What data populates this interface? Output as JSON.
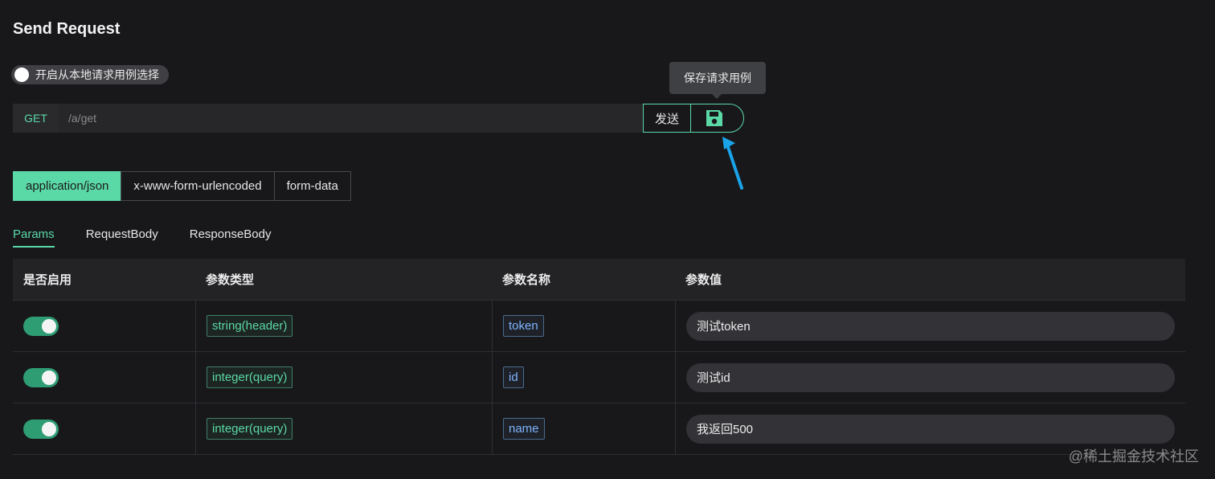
{
  "title": "Send Request",
  "local_switch": {
    "label": "开启从本地请求用例选择",
    "on": false
  },
  "tooltip": "保存请求用例",
  "request": {
    "method": "GET",
    "url_placeholder": "/a/get",
    "send_label": "发送",
    "save_icon": "save-icon"
  },
  "content_types": [
    {
      "label": "application/json",
      "active": true
    },
    {
      "label": "x-www-form-urlencoded",
      "active": false
    },
    {
      "label": "form-data",
      "active": false
    }
  ],
  "tabs": [
    {
      "label": "Params",
      "active": true
    },
    {
      "label": "RequestBody",
      "active": false
    },
    {
      "label": "ResponseBody",
      "active": false
    }
  ],
  "table": {
    "headers": [
      "是否启用",
      "参数类型",
      "参数名称",
      "参数值"
    ],
    "rows": [
      {
        "enabled": true,
        "type": "string(header)",
        "name": "token",
        "value": "测试token"
      },
      {
        "enabled": true,
        "type": "integer(query)",
        "name": "id",
        "value": "测试id"
      },
      {
        "enabled": true,
        "type": "integer(query)",
        "name": "name",
        "value": "我返回500"
      }
    ]
  },
  "watermark": "@稀土掘金技术社区",
  "colors": {
    "accent": "#5ad8a6",
    "background": "#18181b",
    "arrow": "#1aa3e8"
  }
}
